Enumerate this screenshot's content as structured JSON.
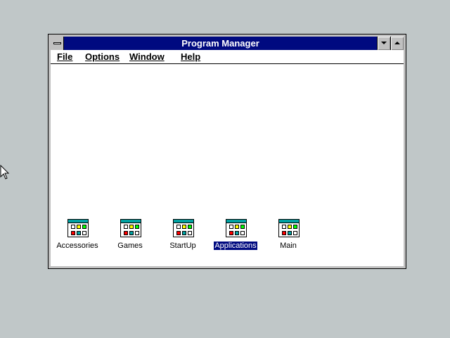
{
  "window": {
    "title": "Program Manager"
  },
  "menu": {
    "items": [
      {
        "label": "File"
      },
      {
        "label": "Options"
      },
      {
        "label": "Window"
      },
      {
        "label": "Help"
      }
    ]
  },
  "groups": [
    {
      "label": "Accessories",
      "icon": "program-group-icon",
      "selected": false
    },
    {
      "label": "Games",
      "icon": "program-group-icon",
      "selected": false
    },
    {
      "label": "StartUp",
      "icon": "program-group-icon",
      "selected": false
    },
    {
      "label": "Applications",
      "icon": "program-group-icon",
      "selected": true
    },
    {
      "label": "Main",
      "icon": "program-group-icon",
      "selected": false
    }
  ],
  "colors": {
    "desktop": "#c0c7c8",
    "title_bar": "#000a80",
    "selection": "#000a80"
  }
}
